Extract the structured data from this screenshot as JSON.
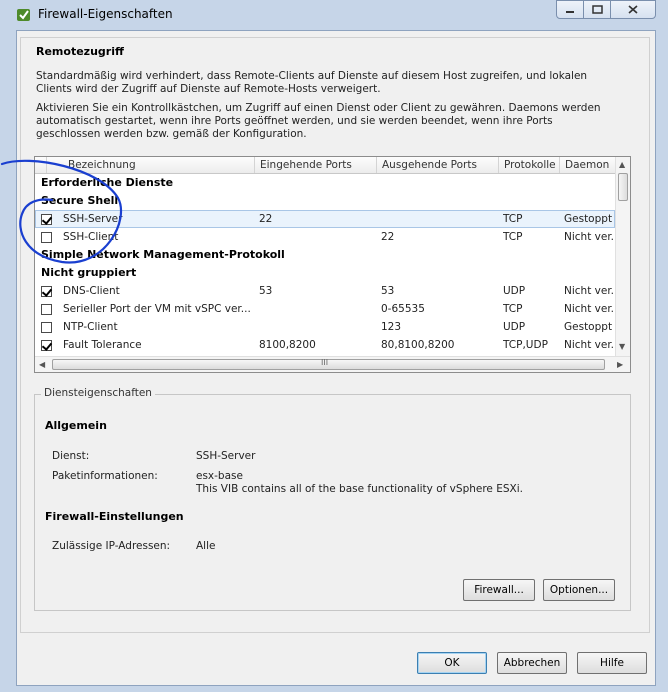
{
  "window": {
    "title": "Firewall-Eigenschaften"
  },
  "remote_access": {
    "heading": "Remotezugriff",
    "para1": "Standardmäßig wird verhindert, dass Remote-Clients auf Dienste auf diesem Host zugreifen, und lokalen Clients wird der Zugriff auf Dienste auf Remote-Hosts verweigert.",
    "para2": "Aktivieren Sie ein Kontrollkästchen, um Zugriff auf einen Dienst oder Client zu gewähren. Daemons werden automatisch gestartet, wenn ihre Ports geöffnet werden, und sie werden beendet, wenn ihre Ports geschlossen werden bzw. gemäß der Konfiguration."
  },
  "table": {
    "columns": [
      "Bezeichnung",
      "Eingehende Ports",
      "Ausgehende Ports",
      "Protokolle",
      "Daemon"
    ],
    "rows": [
      {
        "type": "group",
        "name": "Erforderliche Dienste"
      },
      {
        "type": "group",
        "name": "Secure Shell"
      },
      {
        "type": "item",
        "checked": true,
        "selected": true,
        "name": "SSH-Server",
        "in": "22",
        "out": "",
        "proto": "TCP",
        "daemon": "Gestoppt"
      },
      {
        "type": "item",
        "checked": false,
        "name": "SSH-Client",
        "in": "",
        "out": "22",
        "proto": "TCP",
        "daemon": "Nicht ver..."
      },
      {
        "type": "group",
        "name": "Simple Network Management-Protokoll"
      },
      {
        "type": "group",
        "name": "Nicht gruppiert"
      },
      {
        "type": "item",
        "checked": true,
        "name": "DNS-Client",
        "in": "53",
        "out": "53",
        "proto": "UDP",
        "daemon": "Nicht ver..."
      },
      {
        "type": "item",
        "checked": false,
        "name": "Serieller Port der VM mit vSPC ver...",
        "in": "",
        "out": "0-65535",
        "proto": "TCP",
        "daemon": "Nicht ver..."
      },
      {
        "type": "item",
        "checked": false,
        "name": "NTP-Client",
        "in": "",
        "out": "123",
        "proto": "UDP",
        "daemon": "Gestoppt"
      },
      {
        "type": "item",
        "checked": true,
        "name": "Fault Tolerance",
        "in": "8100,8200",
        "out": "80,8100,8200",
        "proto": "TCP,UDP",
        "daemon": "Nicht ver..."
      }
    ],
    "hscroll_grip": "III"
  },
  "service_props": {
    "legend": "Diensteigenschaften",
    "general_heading": "Allgemein",
    "service_label": "Dienst:",
    "service_value": "SSH-Server",
    "package_label": "Paketinformationen:",
    "package_value1": "esx-base",
    "package_value2": "This VIB contains all of the base functionality of vSphere ESXi.",
    "firewall_heading": "Firewall-Einstellungen",
    "ip_label": "Zulässige IP-Adressen:",
    "ip_value": "Alle",
    "firewall_button": "Firewall...",
    "options_button": "Optionen..."
  },
  "footer": {
    "ok": "OK",
    "cancel": "Abbrechen",
    "help": "Hilfe"
  },
  "colors": {
    "annotation": "#1a3fd0",
    "frame": "#c6d5e8"
  }
}
